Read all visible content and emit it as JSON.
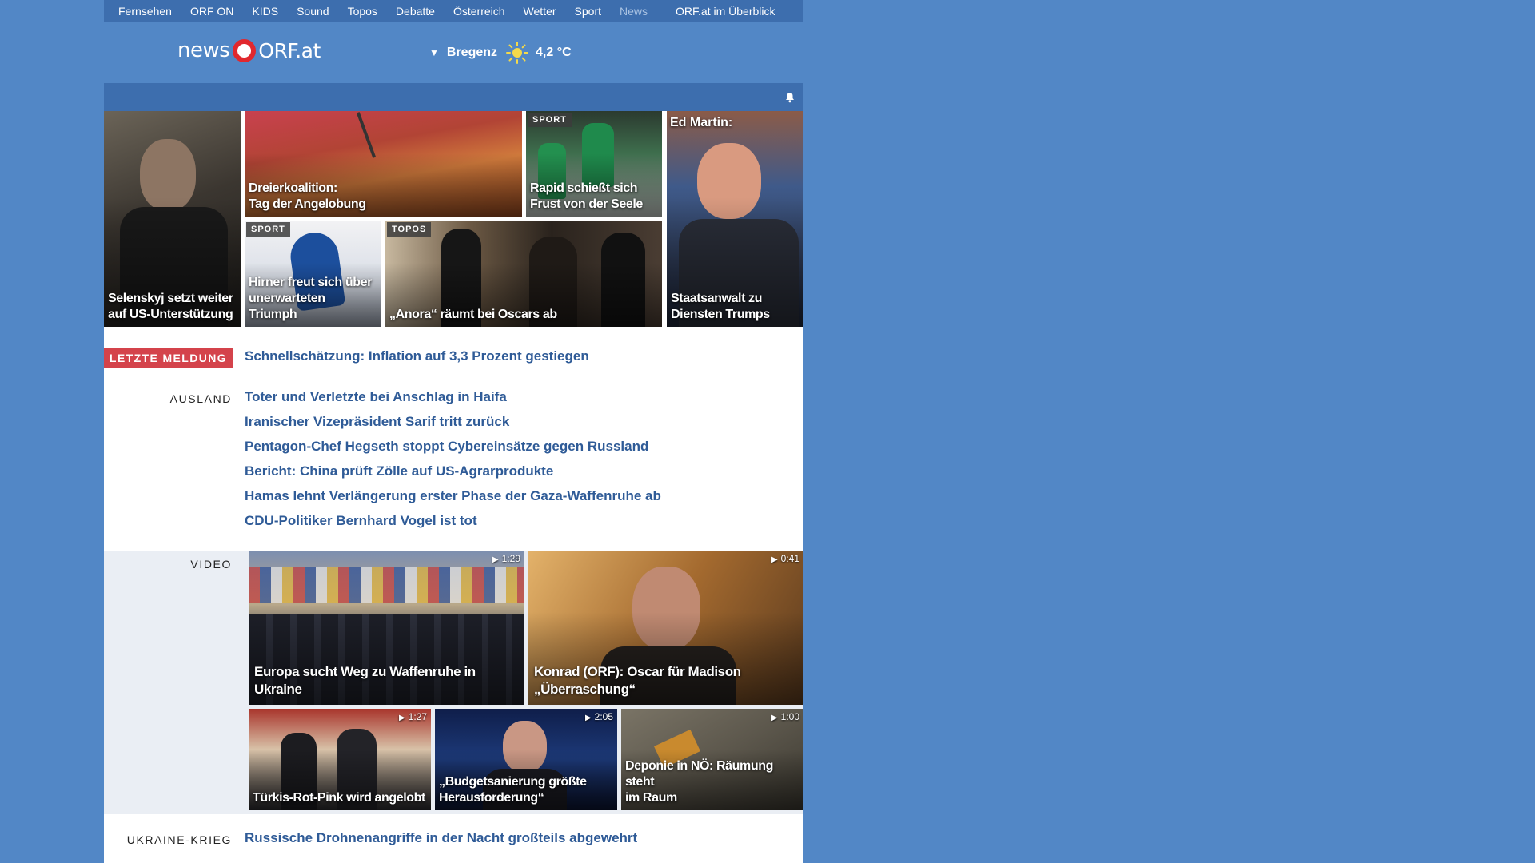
{
  "topnav": {
    "items": [
      "Fernsehen",
      "ORF ON",
      "KIDS",
      "Sound",
      "Topos",
      "Debatte",
      "Österreich",
      "Wetter",
      "Sport",
      "News"
    ],
    "overview": "ORF.at im Überblick"
  },
  "header": {
    "logo_news": "news",
    "logo_orf": "ORF.at",
    "weather": {
      "location": "Bregenz",
      "temperature": "4,2 °C",
      "icon": "sun-icon"
    }
  },
  "colors": {
    "background": "#5287c6",
    "navbar": "#3d6eae",
    "link": "#2f5b97",
    "badge": "#d4434b"
  },
  "teasers": [
    {
      "line1": "Selenskyj setzt weiter",
      "line2": "auf US-Unterstützung",
      "tag": ""
    },
    {
      "line1": "Dreierkoalition:",
      "line2": "Tag der Angelobung",
      "tag": ""
    },
    {
      "line1": "Rapid schießt sich",
      "line2": "Frust von der Seele",
      "tag": "SPORT"
    },
    {
      "kicker": "Ed Martin:",
      "line1": "Staatsanwalt zu",
      "line2": "Diensten Trumps",
      "tag": ""
    },
    {
      "line1": "Hirner freut sich über",
      "line2": "unerwarteten Triumph",
      "tag": "SPORT"
    },
    {
      "line1": "„Anora“ räumt bei Oscars ab",
      "line2": "",
      "tag": "TOPOS"
    }
  ],
  "letzte_meldung": {
    "label": "LETZTE MELDUNG",
    "text": "Schnellschätzung: Inflation auf 3,3 Prozent gestiegen"
  },
  "ausland": {
    "label": "AUSLAND",
    "links": [
      "Toter und Verletzte bei Anschlag in Haifa",
      "Iranischer Vizepräsident Sarif tritt zurück",
      "Pentagon-Chef Hegseth stoppt Cybereinsätze gegen Russland",
      "Bericht: China prüft Zölle auf US-Agrarprodukte",
      "Hamas lehnt Verlängerung erster Phase der Gaza-Waffenruhe ab",
      "CDU-Politiker Bernhard Vogel ist tot"
    ]
  },
  "video": {
    "label": "VIDEO",
    "items": [
      {
        "line1": "Europa sucht Weg zu Waffenruhe in",
        "line2": "Ukraine",
        "duration": "1:29"
      },
      {
        "line1": "Konrad (ORF): Oscar für Madison",
        "line2": "„Überraschung“",
        "duration": "0:41"
      },
      {
        "line1": "Türkis-Rot-Pink wird angelobt",
        "line2": "",
        "duration": "1:27"
      },
      {
        "line1": "„Budgetsanierung größte",
        "line2": "Herausforderung“",
        "duration": "2:05"
      },
      {
        "line1": "Deponie in NÖ: Räumung steht",
        "line2": "im Raum",
        "duration": "1:00"
      }
    ]
  },
  "ukraine": {
    "label": "UKRAINE-KRIEG",
    "link": "Russische Drohnenangriffe in der Nacht großteils abgewehrt"
  }
}
